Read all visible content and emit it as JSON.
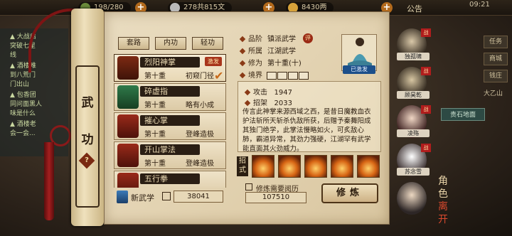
{
  "topbar": {
    "energy": "198/280",
    "silver": "278共815文",
    "gold": "8430两",
    "notice": "公告",
    "time": "09:21"
  },
  "left_panel": {
    "lines": [
      "▲ 大战启",
      "突破七星",
      "线",
      "▲ 酒楼难",
      "到八荒门",
      "门出山",
      "▲ 包香团",
      "同问面黑人",
      "味是什么",
      "▲ 酒楼老",
      "会一会..."
    ]
  },
  "right_panel": {
    "buttons": [
      "任务",
      "商城",
      "钱庄"
    ],
    "place": "大乙山",
    "guide": "责石地面"
  },
  "scroll": {
    "title_chars": [
      "武",
      "功"
    ],
    "help": "?"
  },
  "tabs": [
    "套路",
    "内功",
    "轻功"
  ],
  "skills": [
    {
      "name": "烈阳神掌",
      "level": "第十重",
      "rank": "初窥门径",
      "badge": "激发",
      "selected": true
    },
    {
      "name": "碎虚指",
      "level": "第十重",
      "rank": "略有小成",
      "badge": "",
      "selected": false
    },
    {
      "name": "摧心掌",
      "level": "第十重",
      "rank": "登峰造极",
      "badge": "",
      "selected": false
    },
    {
      "name": "开山掌法",
      "level": "第十重",
      "rank": "登峰造极",
      "badge": "",
      "selected": false
    },
    {
      "name": "五行拳",
      "level": "",
      "rank": "",
      "badge": "",
      "selected": false
    }
  ],
  "new_skill": {
    "label": "新武学",
    "value": "38041"
  },
  "info": {
    "grade_label": "品阶",
    "grade_value": "镇派武学",
    "grade_mark": "评",
    "belong_label": "所属",
    "belong_value": "江湖武学",
    "cultivation_label": "修为",
    "cultivation_value": "第十重(十)",
    "realm_label": "境界",
    "equipped": "已激发"
  },
  "stats": {
    "attack_label": "攻击",
    "attack_value": "1947",
    "moves_label": "招架",
    "moves_value": "2033"
  },
  "description": "传言此神掌来源西域之西，是昔日魔教血衣护法斩所天斩杀仇敌所获，后赠予秦舞阳成其独门绝学，此掌法慢略如火，可炙敌心肺，霸道异常，其劲力强硬，江湖罕有武学能直面其火劲威力。",
  "moves_tag": "招式",
  "training": {
    "requirement_label": "修炼需要阅历",
    "requirement_value": "107510",
    "button": "修炼"
  },
  "characters": [
    {
      "name": "独孤啸",
      "war": "战"
    },
    {
      "name": "顾昊乾",
      "war": "战"
    },
    {
      "name": "凌殇",
      "war": "战"
    },
    {
      "name": "苏念雪",
      "war": "战"
    },
    {
      "name": "",
      "war": ""
    }
  ],
  "roles_text": "角色",
  "leave_text": "离开",
  "colors": {
    "accent": "#a8351c",
    "ink": "#2b1c0e",
    "paper": "#e6d7b6"
  }
}
